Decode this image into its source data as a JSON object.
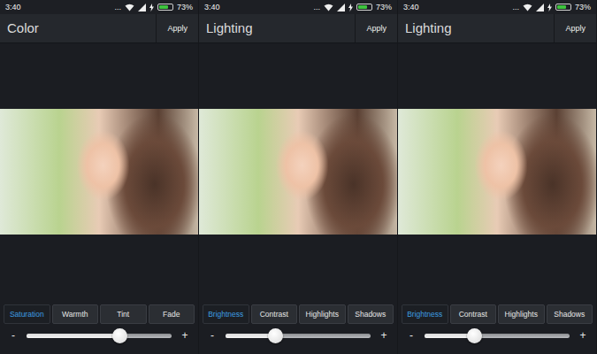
{
  "screens": [
    {
      "status_bar": {
        "time": "3:40",
        "dots": "...",
        "battery": {
          "reading": "73%",
          "level": 0.73,
          "charging": true
        }
      },
      "title": "Color",
      "apply": "Apply",
      "tabs": [
        {
          "label": "Saturation",
          "selected": true
        },
        {
          "label": "Warmth",
          "selected": false
        },
        {
          "label": "Tint",
          "selected": false
        },
        {
          "label": "Fade",
          "selected": false
        }
      ],
      "slider": {
        "minus": "-",
        "plus": "+",
        "level": 0.64
      }
    },
    {
      "status_bar": {
        "time": "3:40",
        "dots": "...",
        "battery": {
          "reading": "73%",
          "level": 0.73,
          "charging": true
        }
      },
      "title": "Lighting",
      "apply": "Apply",
      "tabs": [
        {
          "label": "Brightness",
          "selected": true
        },
        {
          "label": "Contrast",
          "selected": false
        },
        {
          "label": "Highlights",
          "selected": false
        },
        {
          "label": "Shadows",
          "selected": false
        }
      ],
      "slider": {
        "minus": "-",
        "plus": "+",
        "level": 0.34
      }
    },
    {
      "status_bar": {
        "time": "3:40",
        "dots": "...",
        "battery": {
          "reading": "73%",
          "level": 0.73,
          "charging": true
        }
      },
      "title": "Lighting",
      "apply": "Apply",
      "tabs": [
        {
          "label": "Brightness",
          "selected": true
        },
        {
          "label": "Contrast",
          "selected": false
        },
        {
          "label": "Highlights",
          "selected": false
        },
        {
          "label": "Shadows",
          "selected": false
        }
      ],
      "slider": {
        "minus": "-",
        "plus": "+",
        "level": 0.34
      }
    }
  ]
}
